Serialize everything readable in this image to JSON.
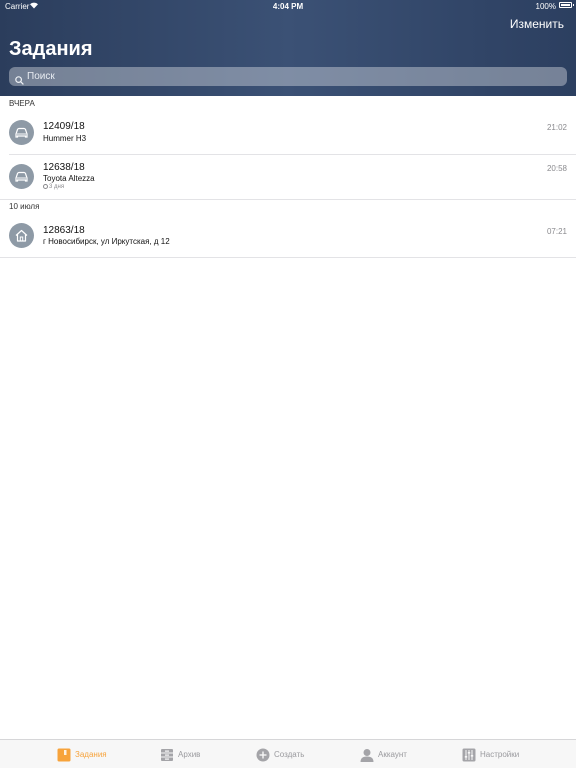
{
  "status": {
    "carrier": "Carrier",
    "time": "4:04 PM",
    "battery": "100%",
    "battery_level": 1.0
  },
  "header": {
    "title": "Задания",
    "edit_label": "Изменить"
  },
  "search": {
    "placeholder": "Поиск"
  },
  "sections": [
    {
      "title": "ВЧЕРА",
      "items": [
        {
          "number": "12409/18",
          "subtitle": "Hummer H3",
          "time": "21:02",
          "icon": "car-icon"
        },
        {
          "number": "12638/18",
          "subtitle": "Toyota Altezza",
          "meta": "3 дня",
          "time": "20:58",
          "icon": "car-icon"
        }
      ]
    },
    {
      "title": "10 июля",
      "items": [
        {
          "number": "12863/18",
          "subtitle": "г Новосибирск, ул Иркутская, д 12",
          "time": "07:21",
          "icon": "house-icon"
        }
      ]
    }
  ],
  "tabs": [
    {
      "label": "Задания",
      "icon": "tasks-icon",
      "active": true
    },
    {
      "label": "Архив",
      "icon": "archive-icon",
      "active": false
    },
    {
      "label": "Создать",
      "icon": "plus-circle-icon",
      "active": false
    },
    {
      "label": "Аккаунт",
      "icon": "person-icon",
      "active": false
    },
    {
      "label": "Настройки",
      "icon": "sliders-icon",
      "active": false
    }
  ],
  "colors": {
    "header": "#34496b",
    "accent": "#f7a33b",
    "avatar": "#8e9aa6",
    "tab_inactive": "#9a9a9e"
  }
}
